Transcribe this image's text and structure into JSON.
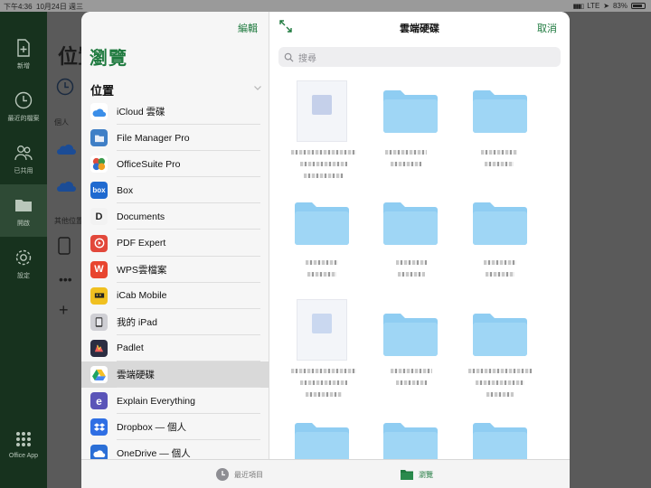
{
  "status_bar": {
    "time": "下午4:36",
    "date": "10月24日 週三",
    "network": "LTE",
    "battery": "83%"
  },
  "office_app": {
    "sidebar": [
      {
        "label": "新增",
        "icon": "new-file-icon"
      },
      {
        "label": "最近的檔案",
        "icon": "clock-icon"
      },
      {
        "label": "已共用",
        "icon": "people-icon"
      },
      {
        "label": "開啟",
        "icon": "folder-icon"
      },
      {
        "label": "設定",
        "icon": "gear-icon"
      },
      {
        "label": "Office App",
        "icon": "grid-icon"
      }
    ],
    "title": "位置",
    "section_personal": "個人",
    "section_other": "其他位置"
  },
  "left_pane": {
    "edit": "編輯",
    "title": "瀏覽",
    "locations_header": "位置",
    "locations": [
      {
        "label": "iCloud 雲碟",
        "icon": "icloud-icon",
        "color": "#3b8ee8"
      },
      {
        "label": "File Manager Pro",
        "icon": "file-manager-pro-icon",
        "color": "#3f7fc6"
      },
      {
        "label": "OfficeSuite Pro",
        "icon": "officesuite-pro-icon",
        "color": "#e04b3a"
      },
      {
        "label": "Box",
        "icon": "box-icon",
        "glyph": "box",
        "color": "#1f6ad0"
      },
      {
        "label": "Documents",
        "icon": "documents-icon",
        "glyph": "D",
        "color": "#f2f2f2"
      },
      {
        "label": "PDF Expert",
        "icon": "pdf-expert-icon",
        "color": "#e2483b"
      },
      {
        "label": "WPS雲檔案",
        "icon": "wps-icon",
        "glyph": "W",
        "color": "#e8452f"
      },
      {
        "label": "iCab Mobile",
        "icon": "icab-mobile-icon",
        "color": "#f0c020"
      },
      {
        "label": "我的 iPad",
        "icon": "ipad-icon",
        "color": "#cfcfd4"
      },
      {
        "label": "Padlet",
        "icon": "padlet-icon",
        "color": "#2b2d42"
      },
      {
        "label": "雲端硬碟",
        "icon": "google-drive-icon",
        "color": "#ffffff"
      },
      {
        "label": "Explain Everything",
        "icon": "explain-everything-icon",
        "glyph": "e",
        "color": "#5a54b8"
      },
      {
        "label": "Dropbox — 個人",
        "icon": "dropbox-icon",
        "color": "#2f6fe4"
      },
      {
        "label": "OneDrive — 個人",
        "icon": "onedrive-icon",
        "color": "#2b6fd6"
      }
    ],
    "selected_index": 10
  },
  "right_pane": {
    "title": "雲端硬碟",
    "cancel": "取消",
    "search_placeholder": "搜尋",
    "folder_color": "#8fcdf2"
  },
  "tab_bar": {
    "recent": "最近項目",
    "browse": "瀏覽",
    "active": "browse",
    "accent": "#1f7a3f"
  }
}
